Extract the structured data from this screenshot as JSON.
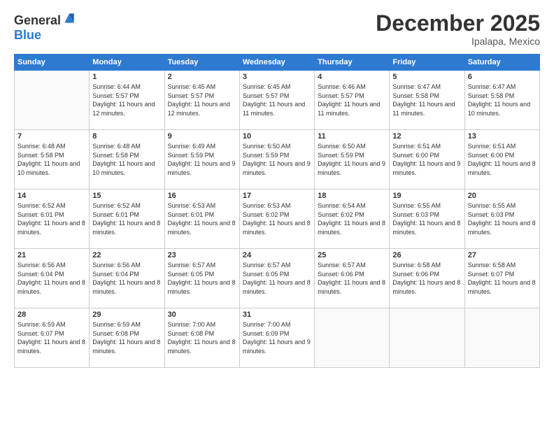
{
  "header": {
    "logo_general": "General",
    "logo_blue": "Blue",
    "title": "December 2025",
    "subtitle": "Ipalapa, Mexico"
  },
  "calendar": {
    "days_of_week": [
      "Sunday",
      "Monday",
      "Tuesday",
      "Wednesday",
      "Thursday",
      "Friday",
      "Saturday"
    ],
    "weeks": [
      [
        {
          "day": "",
          "info": ""
        },
        {
          "day": "1",
          "info": "Sunrise: 6:44 AM\nSunset: 5:57 PM\nDaylight: 11 hours and 12 minutes."
        },
        {
          "day": "2",
          "info": "Sunrise: 6:45 AM\nSunset: 5:57 PM\nDaylight: 11 hours and 12 minutes."
        },
        {
          "day": "3",
          "info": "Sunrise: 6:45 AM\nSunset: 5:57 PM\nDaylight: 11 hours and 11 minutes."
        },
        {
          "day": "4",
          "info": "Sunrise: 6:46 AM\nSunset: 5:57 PM\nDaylight: 11 hours and 11 minutes."
        },
        {
          "day": "5",
          "info": "Sunrise: 6:47 AM\nSunset: 5:58 PM\nDaylight: 11 hours and 11 minutes."
        },
        {
          "day": "6",
          "info": "Sunrise: 6:47 AM\nSunset: 5:58 PM\nDaylight: 11 hours and 10 minutes."
        }
      ],
      [
        {
          "day": "7",
          "info": "Sunrise: 6:48 AM\nSunset: 5:58 PM\nDaylight: 11 hours and 10 minutes."
        },
        {
          "day": "8",
          "info": "Sunrise: 6:48 AM\nSunset: 5:58 PM\nDaylight: 11 hours and 10 minutes."
        },
        {
          "day": "9",
          "info": "Sunrise: 6:49 AM\nSunset: 5:59 PM\nDaylight: 11 hours and 9 minutes."
        },
        {
          "day": "10",
          "info": "Sunrise: 6:50 AM\nSunset: 5:59 PM\nDaylight: 11 hours and 9 minutes."
        },
        {
          "day": "11",
          "info": "Sunrise: 6:50 AM\nSunset: 5:59 PM\nDaylight: 11 hours and 9 minutes."
        },
        {
          "day": "12",
          "info": "Sunrise: 6:51 AM\nSunset: 6:00 PM\nDaylight: 11 hours and 9 minutes."
        },
        {
          "day": "13",
          "info": "Sunrise: 6:51 AM\nSunset: 6:00 PM\nDaylight: 11 hours and 8 minutes."
        }
      ],
      [
        {
          "day": "14",
          "info": "Sunrise: 6:52 AM\nSunset: 6:01 PM\nDaylight: 11 hours and 8 minutes."
        },
        {
          "day": "15",
          "info": "Sunrise: 6:52 AM\nSunset: 6:01 PM\nDaylight: 11 hours and 8 minutes."
        },
        {
          "day": "16",
          "info": "Sunrise: 6:53 AM\nSunset: 6:01 PM\nDaylight: 11 hours and 8 minutes."
        },
        {
          "day": "17",
          "info": "Sunrise: 6:53 AM\nSunset: 6:02 PM\nDaylight: 11 hours and 8 minutes."
        },
        {
          "day": "18",
          "info": "Sunrise: 6:54 AM\nSunset: 6:02 PM\nDaylight: 11 hours and 8 minutes."
        },
        {
          "day": "19",
          "info": "Sunrise: 6:55 AM\nSunset: 6:03 PM\nDaylight: 11 hours and 8 minutes."
        },
        {
          "day": "20",
          "info": "Sunrise: 6:55 AM\nSunset: 6:03 PM\nDaylight: 11 hours and 8 minutes."
        }
      ],
      [
        {
          "day": "21",
          "info": "Sunrise: 6:56 AM\nSunset: 6:04 PM\nDaylight: 11 hours and 8 minutes."
        },
        {
          "day": "22",
          "info": "Sunrise: 6:56 AM\nSunset: 6:04 PM\nDaylight: 11 hours and 8 minutes."
        },
        {
          "day": "23",
          "info": "Sunrise: 6:57 AM\nSunset: 6:05 PM\nDaylight: 11 hours and 8 minutes."
        },
        {
          "day": "24",
          "info": "Sunrise: 6:57 AM\nSunset: 6:05 PM\nDaylight: 11 hours and 8 minutes."
        },
        {
          "day": "25",
          "info": "Sunrise: 6:57 AM\nSunset: 6:06 PM\nDaylight: 11 hours and 8 minutes."
        },
        {
          "day": "26",
          "info": "Sunrise: 6:58 AM\nSunset: 6:06 PM\nDaylight: 11 hours and 8 minutes."
        },
        {
          "day": "27",
          "info": "Sunrise: 6:58 AM\nSunset: 6:07 PM\nDaylight: 11 hours and 8 minutes."
        }
      ],
      [
        {
          "day": "28",
          "info": "Sunrise: 6:59 AM\nSunset: 6:07 PM\nDaylight: 11 hours and 8 minutes."
        },
        {
          "day": "29",
          "info": "Sunrise: 6:59 AM\nSunset: 6:08 PM\nDaylight: 11 hours and 8 minutes."
        },
        {
          "day": "30",
          "info": "Sunrise: 7:00 AM\nSunset: 6:08 PM\nDaylight: 11 hours and 8 minutes."
        },
        {
          "day": "31",
          "info": "Sunrise: 7:00 AM\nSunset: 6:09 PM\nDaylight: 11 hours and 9 minutes."
        },
        {
          "day": "",
          "info": ""
        },
        {
          "day": "",
          "info": ""
        },
        {
          "day": "",
          "info": ""
        }
      ]
    ]
  }
}
